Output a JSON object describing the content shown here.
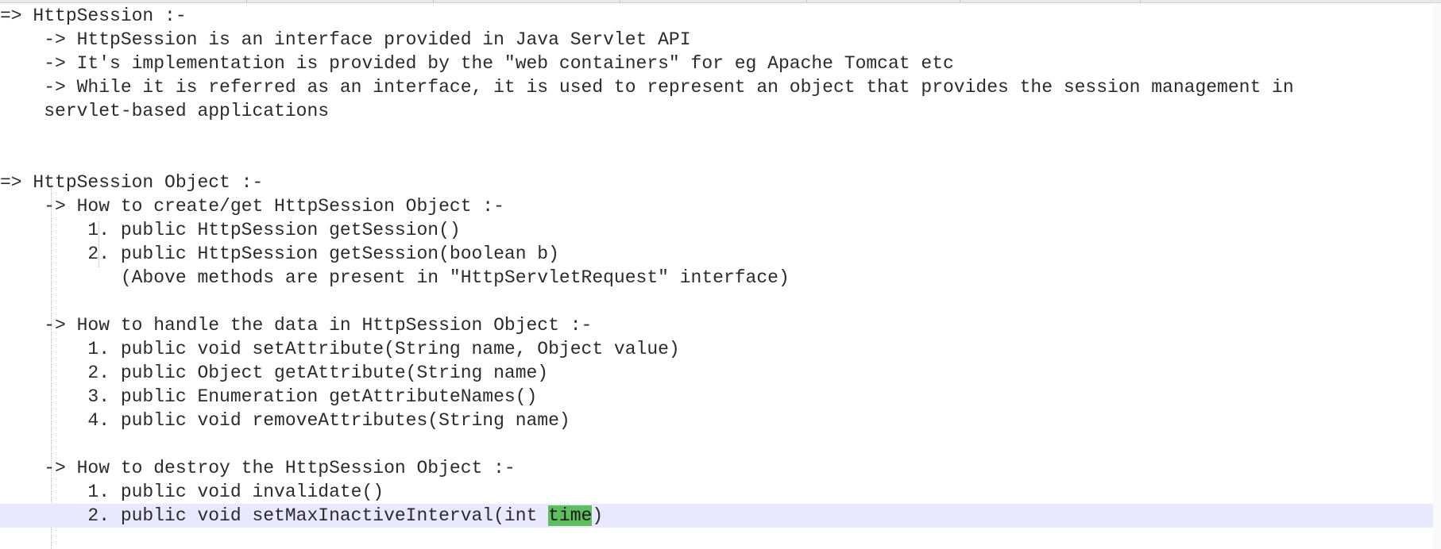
{
  "editor": {
    "lines": [
      "=> HttpSession :-",
      "    -> HttpSession is an interface provided in Java Servlet API",
      "    -> It's implementation is provided by the \"web containers\" for eg Apache Tomcat etc",
      "    -> While it is referred as an interface, it is used to represent an object that provides the session management in",
      "    servlet-based applications",
      "",
      "",
      "=> HttpSession Object :-",
      "    -> How to create/get HttpSession Object :-",
      "        1. public HttpSession getSession()",
      "        2. public HttpSession getSession(boolean b)",
      "           (Above methods are present in \"HttpServletRequest\" interface)",
      "",
      "    -> How to handle the data in HttpSession Object :-",
      "        1. public void setAttribute(String name, Object value)",
      "        2. public Object getAttribute(String name)",
      "        3. public Enumeration getAttributeNames()",
      "        4. public void removeAttributes(String name)",
      "",
      "    -> How to destroy the HttpSession Object :-",
      "        1. public void invalidate()"
    ],
    "current_line": {
      "before": "        2. public void setMaxInactiveInterval(int ",
      "selected": "time",
      "after": ")"
    }
  },
  "colors": {
    "current_line_bg": "#e8e8ff",
    "selection_bg": "#5fbf5f"
  }
}
